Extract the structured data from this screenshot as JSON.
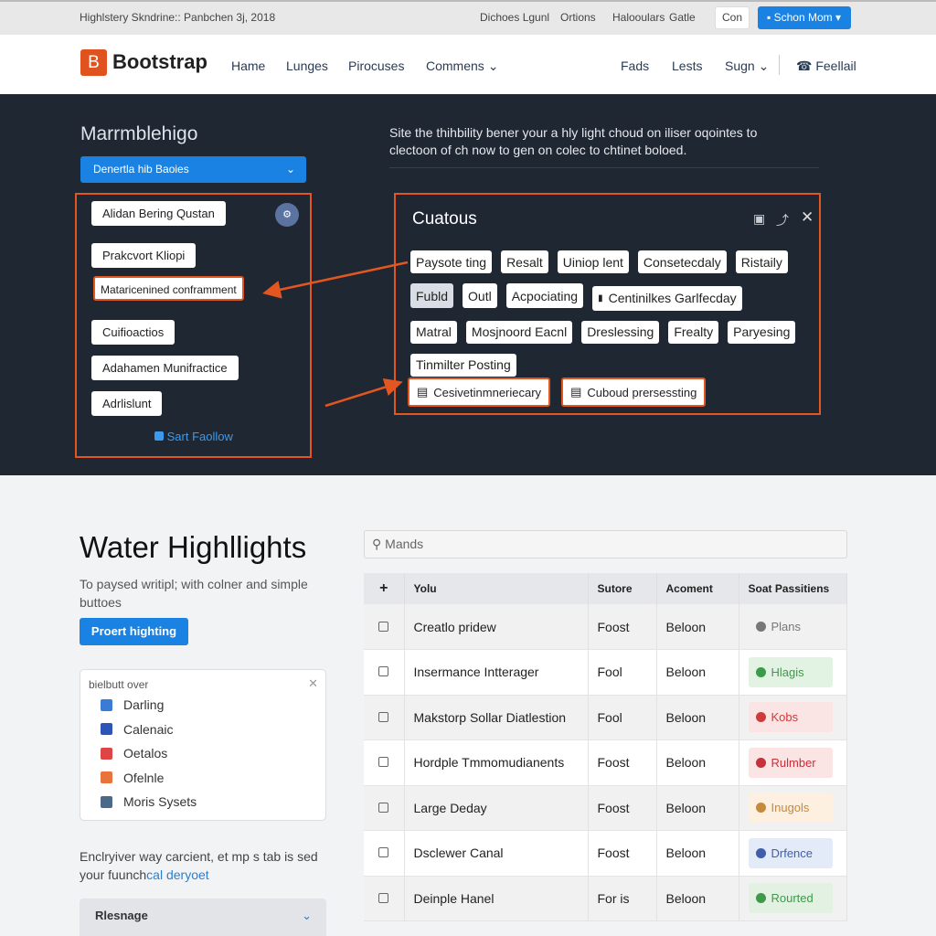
{
  "topbar": {
    "title": "Highlstery Skndrine:: Panbchen 3j, 2018",
    "links": [
      "Dichoes Lgunl",
      "Ortions",
      "Halooulars",
      "Gatle"
    ],
    "con_button": "Con",
    "primary_button": "Schon Mom"
  },
  "nav": {
    "brand": "Bootstrap",
    "brand_letter": "B",
    "items": [
      "Hame",
      "Lunges",
      "Pirocuses",
      "Commens"
    ],
    "right_items": [
      "Fads",
      "Lests",
      "Sugn"
    ],
    "feedback": "Feellail"
  },
  "hero": {
    "heading": "Marrmblehigo",
    "dropdown": "Denertla hib Baoies",
    "list_buttons": [
      "Alidan Bering Qustan",
      "Prakcvort Kliopi",
      "Mataricenined conframment",
      "Cuifioactios",
      "Adahamen Munifractice",
      "Adrlislunt"
    ],
    "link": "Sart Faollow",
    "description": "Site the thihbility bener your a hly light choud on iliser oqointes to clectoon of ch now to gen on colec to chtinet boloed."
  },
  "panel": {
    "title": "Cuatous",
    "chips_row1": [
      "Paysote ting",
      "Resalt",
      "Uiniop lent",
      "Consetecdaly",
      "Ristaily"
    ],
    "chips_row2": [
      "Fubld",
      "Outl",
      "Acpociating",
      "Centinilkes Garlfecday"
    ],
    "chips_row3": [
      "Matral",
      "Mosjnoord Eacnl",
      "Dreslessing",
      "Frealty",
      "Paryesing"
    ],
    "chips_row4": [
      "Tinmilter Posting"
    ],
    "highlighted": [
      "Cesivetinmneriecary",
      "Cuboud prersessting"
    ]
  },
  "left": {
    "heading": "Water Highllights",
    "subtitle": "To paysed writipl; with colner and simple buttoes",
    "button": "Proert highting",
    "card_title": "bielbutt over",
    "card_items": [
      {
        "label": "Darling",
        "color": "#3a7bd5"
      },
      {
        "label": "Calenaic",
        "color": "#2c55b8"
      },
      {
        "label": "Oetalos",
        "color": "#e04545"
      },
      {
        "label": "Ofelnle",
        "color": "#e8743b"
      },
      {
        "label": "Moris Sysets",
        "color": "#4b6a8a"
      }
    ],
    "note": "Enclryiver way carcient, et mp s tab is sed your fuunch",
    "note_link": "cal deryoet",
    "accordion": "Rlesnage"
  },
  "search": {
    "placeholder": "Mands"
  },
  "table": {
    "headers": [
      "+",
      "Yolu",
      "Sutore",
      "Acoment",
      "Soat Passitiens"
    ],
    "rows": [
      {
        "name": "Creatlo pridew",
        "c2": "Foost",
        "c3": "Beloon",
        "status": "Plans",
        "bg": "transparent",
        "fg": "#777"
      },
      {
        "name": "Insermance Intterager",
        "c2": "Fool",
        "c3": "Beloon",
        "status": "Hlagis",
        "bg": "#e3f3e3",
        "fg": "#3d9a4a"
      },
      {
        "name": "Makstorp Sollar Diatlestion",
        "c2": "Fool",
        "c3": "Beloon",
        "status": "Kobs",
        "bg": "#fbe4e4",
        "fg": "#d03a3a"
      },
      {
        "name": "Hordple Tmmomudianents",
        "c2": "Foost",
        "c3": "Beloon",
        "status": "Rulmber",
        "bg": "#fbe4e4",
        "fg": "#c8303a"
      },
      {
        "name": "Large Deday",
        "c2": "Foost",
        "c3": "Beloon",
        "status": "Inugols",
        "bg": "#fdf0e0",
        "fg": "#c58a3c"
      },
      {
        "name": "Dsclewer Canal",
        "c2": "Foost",
        "c3": "Beloon",
        "status": "Drfence",
        "bg": "#e3ebf8",
        "fg": "#3f5fa8"
      },
      {
        "name": "Deinple Hanel",
        "c2": "For is",
        "c3": "Beloon",
        "status": "Rourted",
        "bg": "#e3f1e3",
        "fg": "#3d9a4a"
      }
    ]
  },
  "colors": {
    "accent": "#e2561f",
    "primary": "#1a82e2",
    "dark": "#1f2733"
  }
}
